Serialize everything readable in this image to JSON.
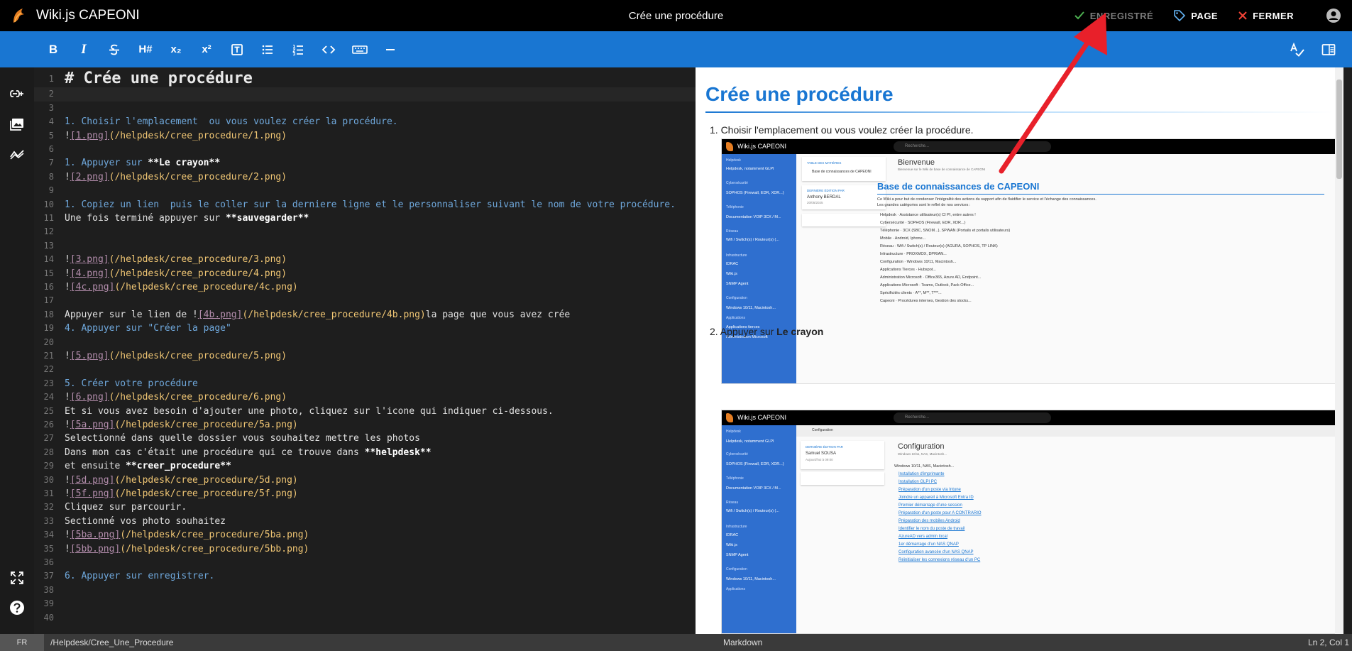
{
  "app": {
    "title": "Wiki.js CAPEONI",
    "document_title": "Crée une procédure"
  },
  "top_actions": {
    "saved": "ENREGISTRÉ",
    "page": "PAGE",
    "close": "FERMER"
  },
  "toolbar": {
    "bold": "B",
    "italic": "I",
    "heading": "H#",
    "subscript": "x₂",
    "superscript": "x²"
  },
  "editor": {
    "lines": [
      {
        "n": "1",
        "parts": [
          [
            "h1",
            "# Crée une procédure"
          ]
        ]
      },
      {
        "n": "2",
        "parts": []
      },
      {
        "n": "3",
        "parts": []
      },
      {
        "n": "4",
        "parts": [
          [
            "list",
            "1. Choisir l'emplacement  ou vous voulez créer la procédure."
          ]
        ]
      },
      {
        "n": "5",
        "parts": [
          [
            "plain",
            "!"
          ],
          [
            "link",
            "[1.png]"
          ],
          [
            "url",
            "(/helpdesk/cree_procedure/1.png)"
          ]
        ]
      },
      {
        "n": "6",
        "parts": []
      },
      {
        "n": "7",
        "parts": [
          [
            "list",
            "1. Appuyer sur "
          ],
          [
            "bold",
            "**Le crayon**"
          ]
        ]
      },
      {
        "n": "8",
        "parts": [
          [
            "plain",
            "!"
          ],
          [
            "link",
            "[2.png]"
          ],
          [
            "url",
            "(/helpdesk/cree_procedure/2.png)"
          ]
        ]
      },
      {
        "n": "9",
        "parts": []
      },
      {
        "n": "10",
        "parts": [
          [
            "list",
            "1. Copiez un lien  puis le coller sur la derniere ligne et le personnaliser suivant le nom de votre procédure."
          ]
        ]
      },
      {
        "n": "11",
        "parts": [
          [
            "plain",
            "Une fois terminé appuyer sur "
          ],
          [
            "bold",
            "**sauvegarder**"
          ]
        ]
      },
      {
        "n": "12",
        "parts": []
      },
      {
        "n": "13",
        "parts": []
      },
      {
        "n": "14",
        "parts": [
          [
            "plain",
            "!"
          ],
          [
            "link",
            "[3.png]"
          ],
          [
            "url",
            "(/helpdesk/cree_procedure/3.png)"
          ]
        ]
      },
      {
        "n": "15",
        "parts": [
          [
            "plain",
            "!"
          ],
          [
            "link",
            "[4.png]"
          ],
          [
            "url",
            "(/helpdesk/cree_procedure/4.png)"
          ]
        ]
      },
      {
        "n": "16",
        "parts": [
          [
            "plain",
            "!"
          ],
          [
            "link",
            "[4c.png]"
          ],
          [
            "url",
            "(/helpdesk/cree_procedure/4c.png)"
          ]
        ]
      },
      {
        "n": "17",
        "parts": []
      },
      {
        "n": "18",
        "parts": [
          [
            "plain",
            "Appuyer sur le lien de !"
          ],
          [
            "link",
            "[4b.png]"
          ],
          [
            "url",
            "(/helpdesk/cree_procedure/4b.png)"
          ],
          [
            "plain",
            "la page que vous avez crée"
          ]
        ]
      },
      {
        "n": "19",
        "parts": [
          [
            "list",
            "4. Appuyer sur \"Créer la page\""
          ]
        ]
      },
      {
        "n": "20",
        "parts": []
      },
      {
        "n": "21",
        "parts": [
          [
            "plain",
            "!"
          ],
          [
            "link",
            "[5.png]"
          ],
          [
            "url",
            "(/helpdesk/cree_procedure/5.png)"
          ]
        ]
      },
      {
        "n": "22",
        "parts": []
      },
      {
        "n": "23",
        "parts": [
          [
            "list",
            "5. Créer votre procédure"
          ]
        ]
      },
      {
        "n": "24",
        "parts": [
          [
            "plain",
            "!"
          ],
          [
            "link",
            "[6.png]"
          ],
          [
            "url",
            "(/helpdesk/cree_procedure/6.png)"
          ]
        ]
      },
      {
        "n": "25",
        "parts": [
          [
            "plain",
            "Et si vous avez besoin d'ajouter une photo, cliquez sur l'icone qui indiquer ci-dessous."
          ]
        ]
      },
      {
        "n": "26",
        "parts": [
          [
            "plain",
            "!"
          ],
          [
            "link",
            "[5a.png]"
          ],
          [
            "url",
            "(/helpdesk/cree_procedure/5a.png)"
          ]
        ]
      },
      {
        "n": "27",
        "parts": [
          [
            "plain",
            "Selectionné dans quelle dossier vous souhaitez mettre les photos"
          ]
        ]
      },
      {
        "n": "28",
        "parts": [
          [
            "plain",
            "Dans mon cas c'était une procédure qui ce trouve dans "
          ],
          [
            "bold",
            "**helpdesk**"
          ]
        ]
      },
      {
        "n": "29",
        "parts": [
          [
            "plain",
            "et ensuite "
          ],
          [
            "bold",
            "**creer_procedure**"
          ]
        ]
      },
      {
        "n": "30",
        "parts": [
          [
            "plain",
            "!"
          ],
          [
            "link",
            "[5d.png]"
          ],
          [
            "url",
            "(/helpdesk/cree_procedure/5d.png)"
          ]
        ]
      },
      {
        "n": "31",
        "parts": [
          [
            "plain",
            "!"
          ],
          [
            "link",
            "[5f.png]"
          ],
          [
            "url",
            "(/helpdesk/cree_procedure/5f.png)"
          ]
        ]
      },
      {
        "n": "32",
        "parts": [
          [
            "plain",
            "Cliquez sur parcourir."
          ]
        ]
      },
      {
        "n": "33",
        "parts": [
          [
            "plain",
            "Sectionné vos photo souhaitez"
          ]
        ]
      },
      {
        "n": "34",
        "parts": [
          [
            "plain",
            "!"
          ],
          [
            "link",
            "[5ba.png]"
          ],
          [
            "url",
            "(/helpdesk/cree_procedure/5ba.png)"
          ]
        ]
      },
      {
        "n": "35",
        "parts": [
          [
            "plain",
            "!"
          ],
          [
            "link",
            "[5bb.png]"
          ],
          [
            "url",
            "(/helpdesk/cree_procedure/5bb.png)"
          ]
        ]
      },
      {
        "n": "36",
        "parts": []
      },
      {
        "n": "37",
        "parts": [
          [
            "list",
            "6. Appuyer sur enregistrer."
          ]
        ]
      },
      {
        "n": "38",
        "parts": []
      },
      {
        "n": "39",
        "parts": []
      },
      {
        "n": "40",
        "parts": []
      }
    ]
  },
  "preview": {
    "title": "Crée une procédure",
    "step1": "1. Choisir l'emplacement ou vous voulez créer la procédure.",
    "step2_prefix": "2. Appuyer sur ",
    "step2_bold": "Le crayon",
    "shot1": {
      "app_title": "Wiki.js CAPEONI",
      "search": "Recherche...",
      "welcome": "Bienvenue",
      "welcome_sub": "Bienvenue sur le Wiki de base de connaissance de CAPEONI",
      "toc_label": "TABLE DES MATIÈRES",
      "toc_item": "Base de connaissances de CAPEONI",
      "last_edit_label": "DERNIÈRE ÉDITION PAR",
      "last_edit_name": "Anthony BERDAL",
      "last_edit_date": "20/05/2025",
      "kb_title": "Base de connaissances de CAPEONI",
      "kb_intro": "Ce Wiki a pour but de condenser l'intégralité des actions du support afin de fluidifier le service et l'échange des connaissances.",
      "kb_intro2": "Les grandes catégories sont le reflet de nos services :",
      "kb_items": [
        "Helpdesk · Assistance utilisateur(s) CI PI, entre autres !",
        "Cybersécurité · SOPHOS (Firewall, EDR, XDR...)",
        "Téléphonie · 3CX (SBC, SNOM...), SPWAN (Portails et portails utilisateurs)",
        "Mobile · Android, Iphone...",
        "Réseau · Wifi / Switch(s) / Routeur(s) (AGURA, SOPHOS, TP LINK)",
        "Infrastructure · PROXMOX, DPRIAN...",
        "Configuration · Windows 10/11, Macintosh...",
        "Applications Tierces · Hubspot...",
        "Administration Microsoft · Office365, Azure AD, Endpoint...",
        "Applications Microsoft · Teams, Outlook, Pack Office...",
        "Spécificités clients · A**, M**, T***...",
        "Capeoni · Procédures internes, Gestion des stocks..."
      ],
      "side_heads": [
        "Helpdesk",
        "Cybersécurité",
        "Téléphonie",
        "Réseau",
        "Infrastructure",
        "Configuration",
        "Applications"
      ],
      "side_items": [
        "Helpdesk, notamment GLPI",
        "SOPHOS (Firewall, EDR, XDR...)",
        "Documentation VOIP 3CX / M...",
        "Wifi / Switch(s) / Routeur(s) (...",
        "IDRAC",
        "Wiki.js",
        "SNMP Agent",
        "Windows 10/11, Macintosh...",
        "Applications tierces",
        "Administration Microsoft"
      ]
    },
    "shot2": {
      "app_title": "Wiki.js CAPEONI",
      "search": "Recherche...",
      "breadcrumb": "Configuration",
      "title": "Configuration",
      "subtitle": "Windows 10/11, NAS, Macintosh...",
      "last_edit_label": "DERNIÈRE ÉDITION PAR",
      "last_edit_name": "Samuel SOUSA",
      "last_edit_date": "Aujourd'hui à 09:00",
      "intro": "Windows 10/11, NAS, Macintosh...",
      "links": [
        "Installation d'imprimante",
        "Installation GLPI PC",
        "Préparation d'un poste via Intune",
        "Joindre un appareil à Microsoft Entra ID",
        "Premier démarrage d'une session",
        "Préparation d'un poste pour A CONTRARIO",
        "Préparation des mobiles Android",
        "Identifier le nom du poste de travail",
        "AzureAD vers admin local",
        "1er démarrage d'un NAS QNAP",
        "Configuration avancée d'un NAS QNAP",
        "Réinitialiser les connexions réseau d'un PC"
      ]
    }
  },
  "statusbar": {
    "lang": "FR",
    "path": "/Helpdesk/Cree_Une_Procedure",
    "mode": "Markdown",
    "position": "Ln 2, Col 1"
  },
  "colors": {
    "accent": "#1976d2",
    "saved_check": "#4caf50",
    "close_x": "#f44336",
    "arrow": "#e8202a"
  }
}
